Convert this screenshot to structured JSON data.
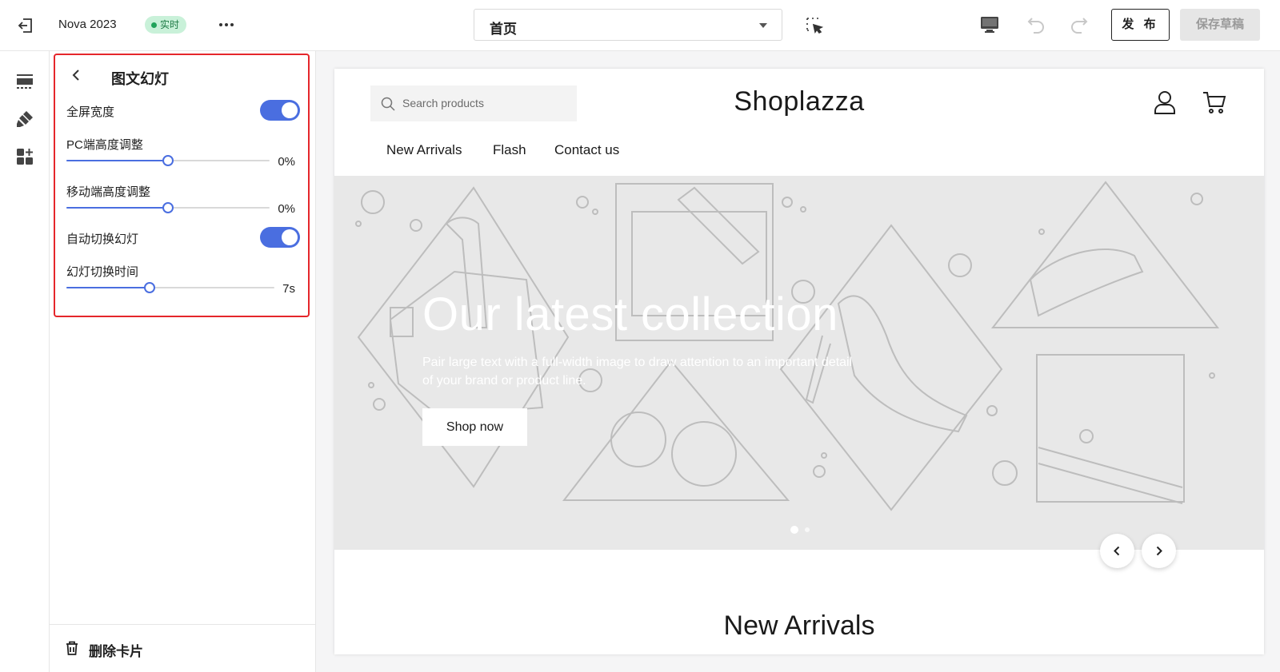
{
  "topbar": {
    "store_name": "Nova 2023",
    "live_badge": "实时",
    "page_select": "首页",
    "publish_label": "发 布",
    "save_draft_label": "保存草稿"
  },
  "panel": {
    "title": "图文幻灯",
    "full_width_label": "全屏宽度",
    "full_width_on": true,
    "pc_height_label": "PC端高度调整",
    "pc_height_value": "0%",
    "pc_height_fraction": 0.5,
    "mobile_height_label": "移动端高度调整",
    "mobile_height_value": "0%",
    "mobile_height_fraction": 0.5,
    "autoplay_label": "自动切换幻灯",
    "autoplay_on": true,
    "interval_label": "幻灯切换时间",
    "interval_value": "7s",
    "interval_fraction": 0.4,
    "delete_label": "删除卡片"
  },
  "preview": {
    "search_placeholder": "Search products",
    "logo": "Shoplazza",
    "nav": [
      "New Arrivals",
      "Flash",
      "Contact us"
    ],
    "hero_title": "Our latest collection",
    "hero_subtitle": "Pair large text with a full-width image to draw attention to an important detail of your brand or product line.",
    "hero_button": "Shop now",
    "slides_total": 2,
    "slide_active": 1,
    "section_title": "New Arrivals"
  },
  "colors": {
    "accent": "#4a6ee0",
    "highlight_border": "#e5262b",
    "badge_bg": "#c9f1d9",
    "badge_dot": "#21a35b"
  },
  "icons": {
    "exit": "exit-icon",
    "more": "more-icon",
    "select_element": "select-element-icon",
    "desktop": "desktop-icon",
    "undo": "undo-icon",
    "redo": "redo-icon",
    "sections": "sections-icon",
    "theme": "paint-brush-icon",
    "apps": "apps-icon",
    "back": "chevron-left-icon",
    "delete": "trash-icon",
    "search": "search-icon",
    "account": "account-icon",
    "cart": "cart-icon"
  }
}
